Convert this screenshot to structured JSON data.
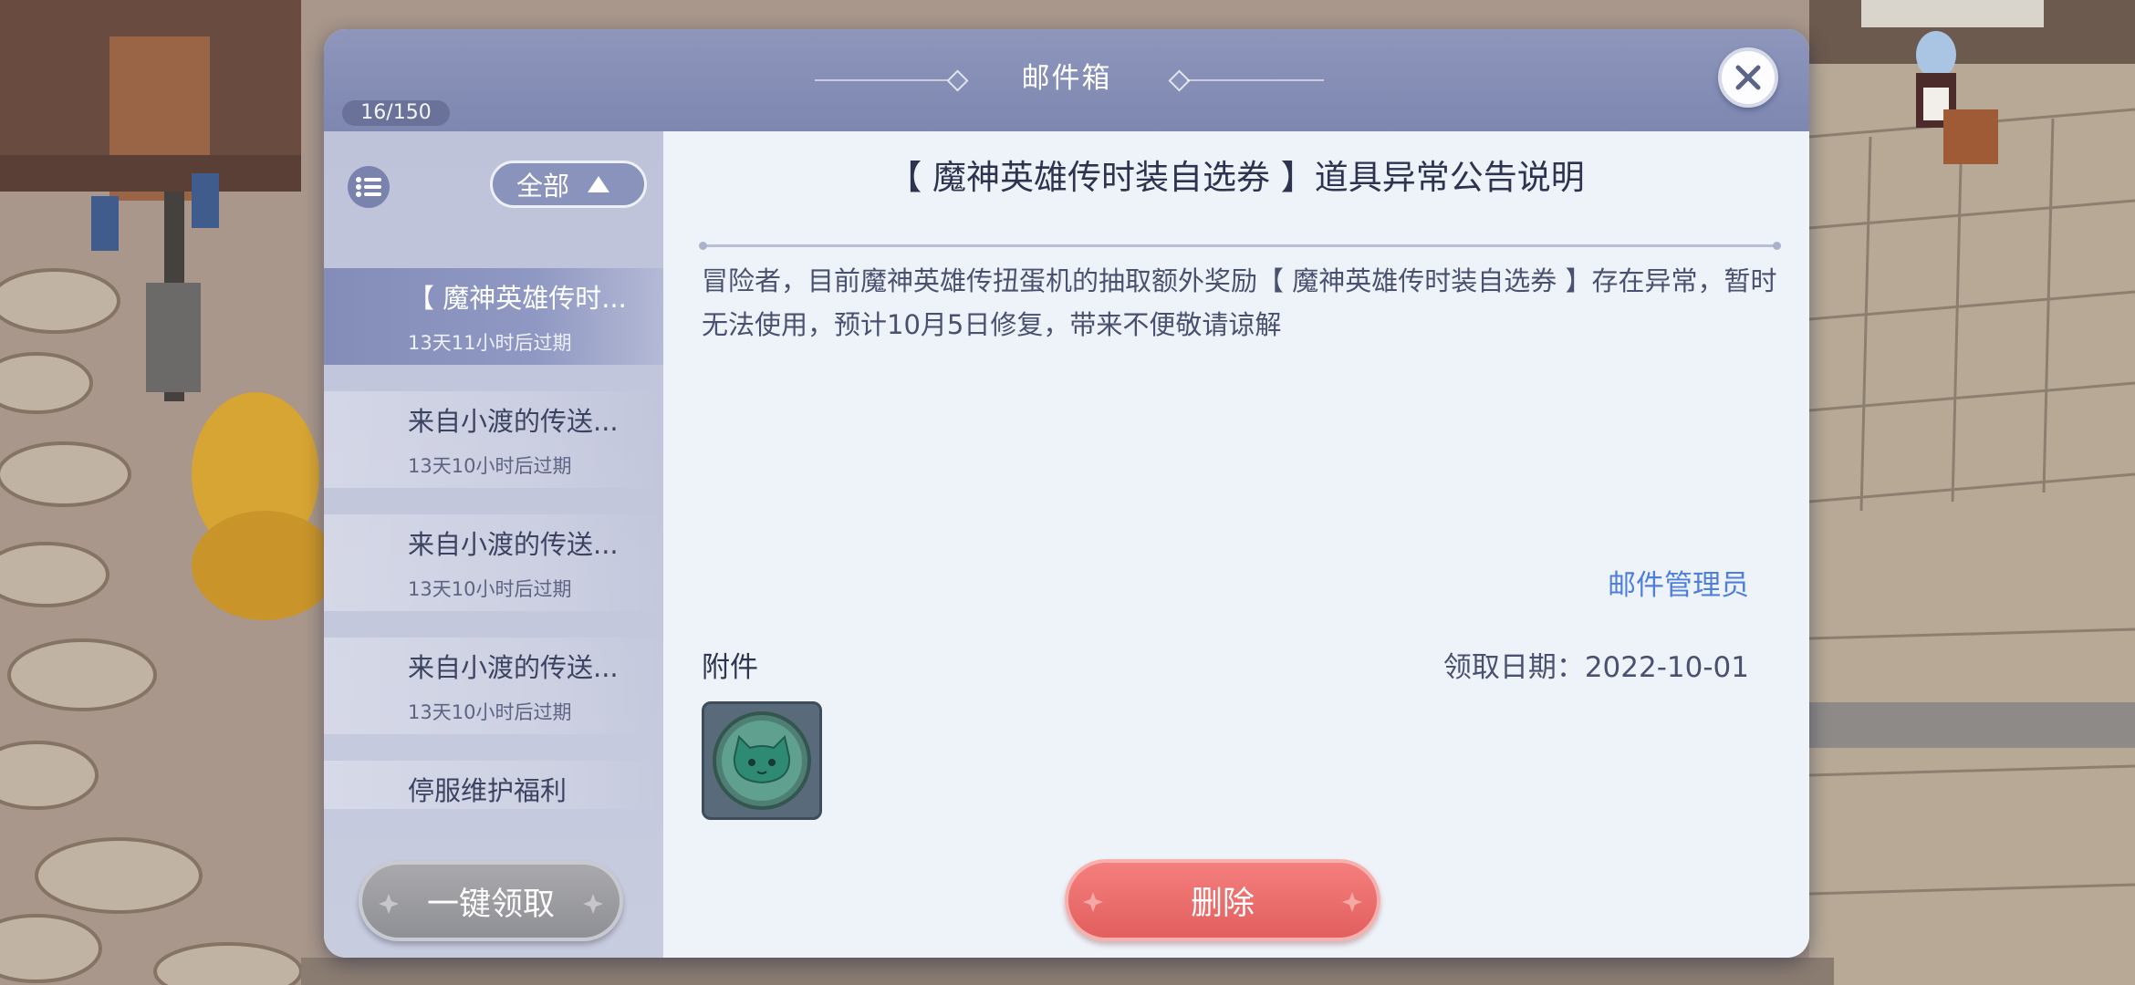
{
  "mailbox": {
    "title": "邮件箱",
    "count": "16/150",
    "filter_label": "全部",
    "claim_all_label": "一键领取",
    "items": [
      {
        "subject": "【 魔神英雄传时...",
        "expiry": "13天11小时后过期",
        "status": "已领取",
        "selected": true
      },
      {
        "subject": "来自小渡的传送...",
        "expiry": "13天10小时后过期",
        "status": "已领取",
        "selected": false
      },
      {
        "subject": "来自小渡的传送...",
        "expiry": "13天10小时后过期",
        "status": "已领取",
        "selected": false
      },
      {
        "subject": "来自小渡的传送...",
        "expiry": "13天10小时后过期",
        "status": "已领取",
        "selected": false
      },
      {
        "subject": "停服维护福利",
        "expiry": "",
        "status": "已领取",
        "selected": false
      }
    ]
  },
  "mail": {
    "title": "【 魔神英雄传时装自选券 】道具异常公告说明",
    "body": "冒险者，目前魔神英雄传扭蛋机的抽取额外奖励【 魔神英雄传时装自选券 】存在异常，暂时无法使用，预计10月5日修复，带来不便敬请谅解",
    "sender": "邮件管理员",
    "attachment_label": "附件",
    "claim_date": "领取日期：2022-10-01",
    "delete_label": "删除"
  },
  "icons": {
    "close": "close-icon",
    "list": "list-icon",
    "filter_arrow": "triangle-up-icon",
    "mail_item": "gift-icon",
    "attachment": "green-cat-token-icon"
  },
  "colors": {
    "header": "#8e96bc",
    "sender_link": "#4f7fdc",
    "delete_button": "#e96a69",
    "claim_all_button": "#9c9ca1"
  }
}
